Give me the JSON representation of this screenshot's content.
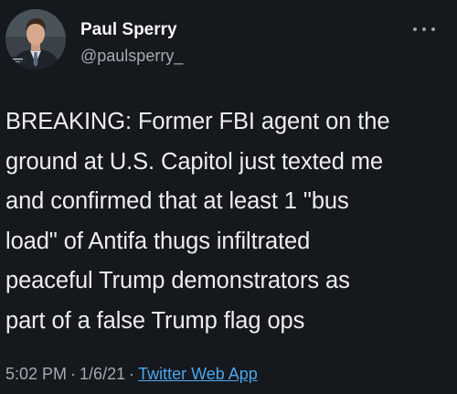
{
  "author": {
    "display_name": "Paul Sperry",
    "handle": "@paulsperry_"
  },
  "icons": {
    "more": "more-options-icon",
    "avatar": "profile-photo"
  },
  "tweet": {
    "lines": [
      "BREAKING: Former FBI agent on the",
      "ground at U.S. Capitol just texted me",
      "and confirmed that at least 1 \"bus",
      "load\" of Antifa thugs infiltrated",
      "peaceful Trump demonstrators as",
      "part of a false Trump flag ops"
    ],
    "time": "5:02 PM",
    "separator": "·",
    "date": "1/6/21",
    "source": "Twitter Web App"
  },
  "colors": {
    "background": "#15181c",
    "text": "#eceeef",
    "secondary_text": "#a4abb2",
    "link": "#4aa6ef"
  }
}
